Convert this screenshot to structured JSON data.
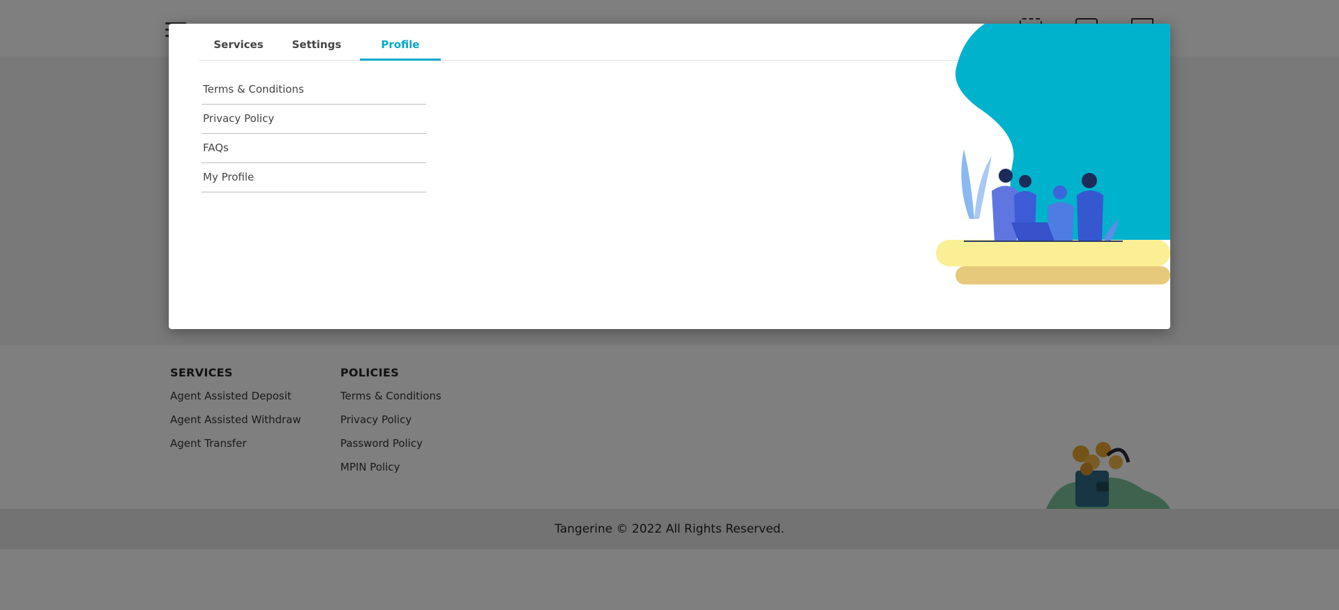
{
  "header": {
    "menu_icon": "hamburger-icon",
    "icons": [
      "scan-icon",
      "card-icon",
      "logout-icon"
    ]
  },
  "modal": {
    "tabs": [
      {
        "label": "Services",
        "active": false
      },
      {
        "label": "Settings",
        "active": false
      },
      {
        "label": "Profile",
        "active": true
      }
    ],
    "menu_items": [
      "Terms & Conditions",
      "Privacy Policy",
      "FAQs",
      "My Profile"
    ],
    "illustration": "team-working-illustration"
  },
  "footer": {
    "services": {
      "heading": "SERVICES",
      "links": [
        "Agent Assisted Deposit",
        "Agent Assisted Withdraw",
        "Agent Transfer"
      ]
    },
    "policies": {
      "heading": "POLICIES",
      "links": [
        "Terms & Conditions",
        "Privacy Policy",
        "Password Policy",
        "MPIN Policy"
      ]
    },
    "illustration": "wallet-coins-illustration",
    "copyright": "Tangerine © 2022 All Rights Reserved."
  },
  "colors": {
    "accent": "#00a9c9",
    "overlay": "rgba(0,0,0,0.5)"
  }
}
